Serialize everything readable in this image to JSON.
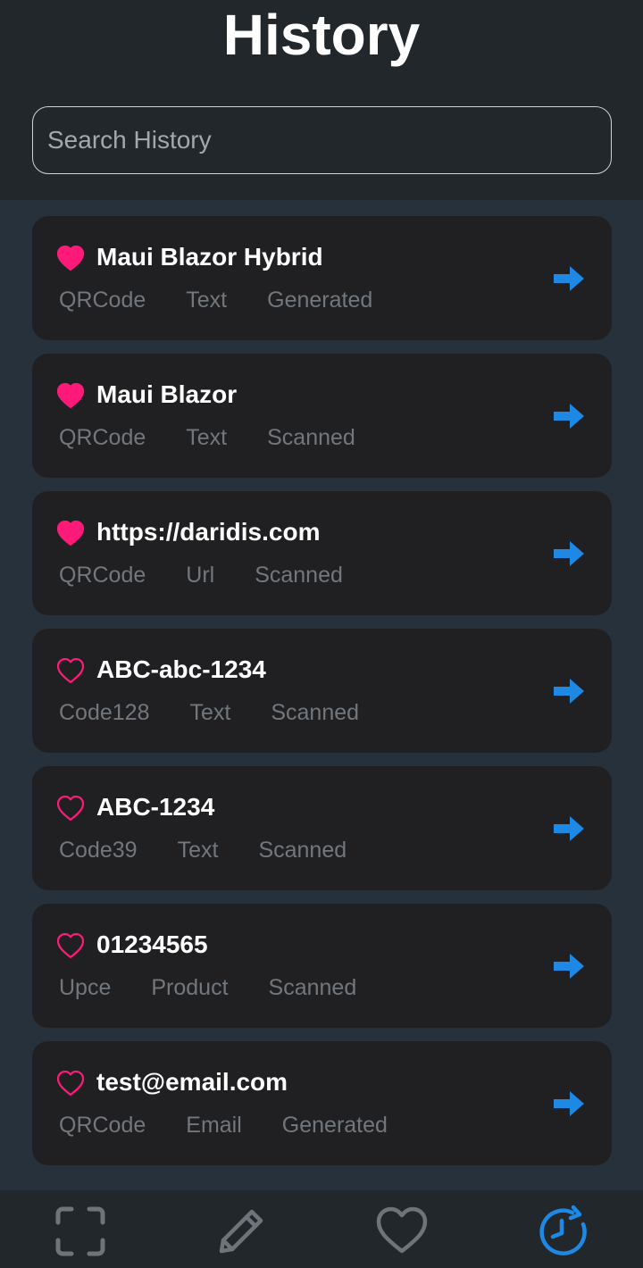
{
  "header": {
    "title": "History",
    "search_placeholder": "Search History",
    "search_value": ""
  },
  "items": [
    {
      "title": "Maui Blazor Hybrid",
      "format": "QRCode",
      "type": "Text",
      "source": "Generated",
      "favorite": true
    },
    {
      "title": "Maui Blazor",
      "format": "QRCode",
      "type": "Text",
      "source": "Scanned",
      "favorite": true
    },
    {
      "title": "https://daridis.com",
      "format": "QRCode",
      "type": "Url",
      "source": "Scanned",
      "favorite": true
    },
    {
      "title": "ABC-abc-1234",
      "format": "Code128",
      "type": "Text",
      "source": "Scanned",
      "favorite": false
    },
    {
      "title": "ABC-1234",
      "format": "Code39",
      "type": "Text",
      "source": "Scanned",
      "favorite": false
    },
    {
      "title": "01234565",
      "format": "Upce",
      "type": "Product",
      "source": "Scanned",
      "favorite": false
    },
    {
      "title": "test@email.com",
      "format": "QRCode",
      "type": "Email",
      "source": "Generated",
      "favorite": false
    }
  ],
  "icons": {
    "favorite": "heart-icon",
    "open": "arrow-right-icon",
    "nav": [
      "scan-icon",
      "pencil-icon",
      "heart-outline-icon",
      "history-icon"
    ]
  },
  "nav": {
    "active": "history"
  },
  "colors": {
    "accent": "#1e88e5",
    "heart": "#ff1a7a",
    "card": "#202022",
    "background": "#27313b",
    "header": "#22272c",
    "muted_text": "#72777d"
  }
}
